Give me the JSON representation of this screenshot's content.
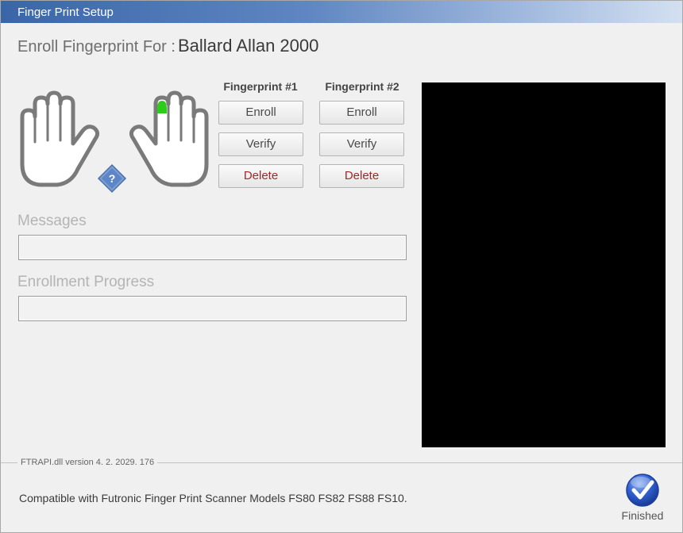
{
  "window": {
    "title": "Finger Print Setup"
  },
  "enroll": {
    "label": "Enroll Fingerprint For :",
    "name": "Ballard Allan  2000"
  },
  "hands": {
    "help_glyph": "?",
    "selected_finger_color": "#2ecc1a"
  },
  "fingerprint1": {
    "header": "Fingerprint #1",
    "enroll": "Enroll",
    "verify": "Verify",
    "delete": "Delete"
  },
  "fingerprint2": {
    "header": "Fingerprint #2",
    "enroll": "Enroll",
    "verify": "Verify",
    "delete": "Delete"
  },
  "messages": {
    "label": "Messages",
    "value": ""
  },
  "progress": {
    "label": "Enrollment Progress",
    "value": ""
  },
  "footer": {
    "version": "FTRAPI.dll version  4. 2. 2029. 176",
    "compatible": "Compatible with Futronic Finger Print Scanner Models  FS80  FS82  FS88  FS10.",
    "finished": "Finished"
  },
  "icons": {
    "left_hand": "left-hand-icon",
    "right_hand": "right-hand-icon",
    "help": "help-icon",
    "finished": "checkmark-icon"
  },
  "colors": {
    "delete_text": "#a02828",
    "scanner_bg": "#000000",
    "title_bar": "#3a66a8"
  }
}
